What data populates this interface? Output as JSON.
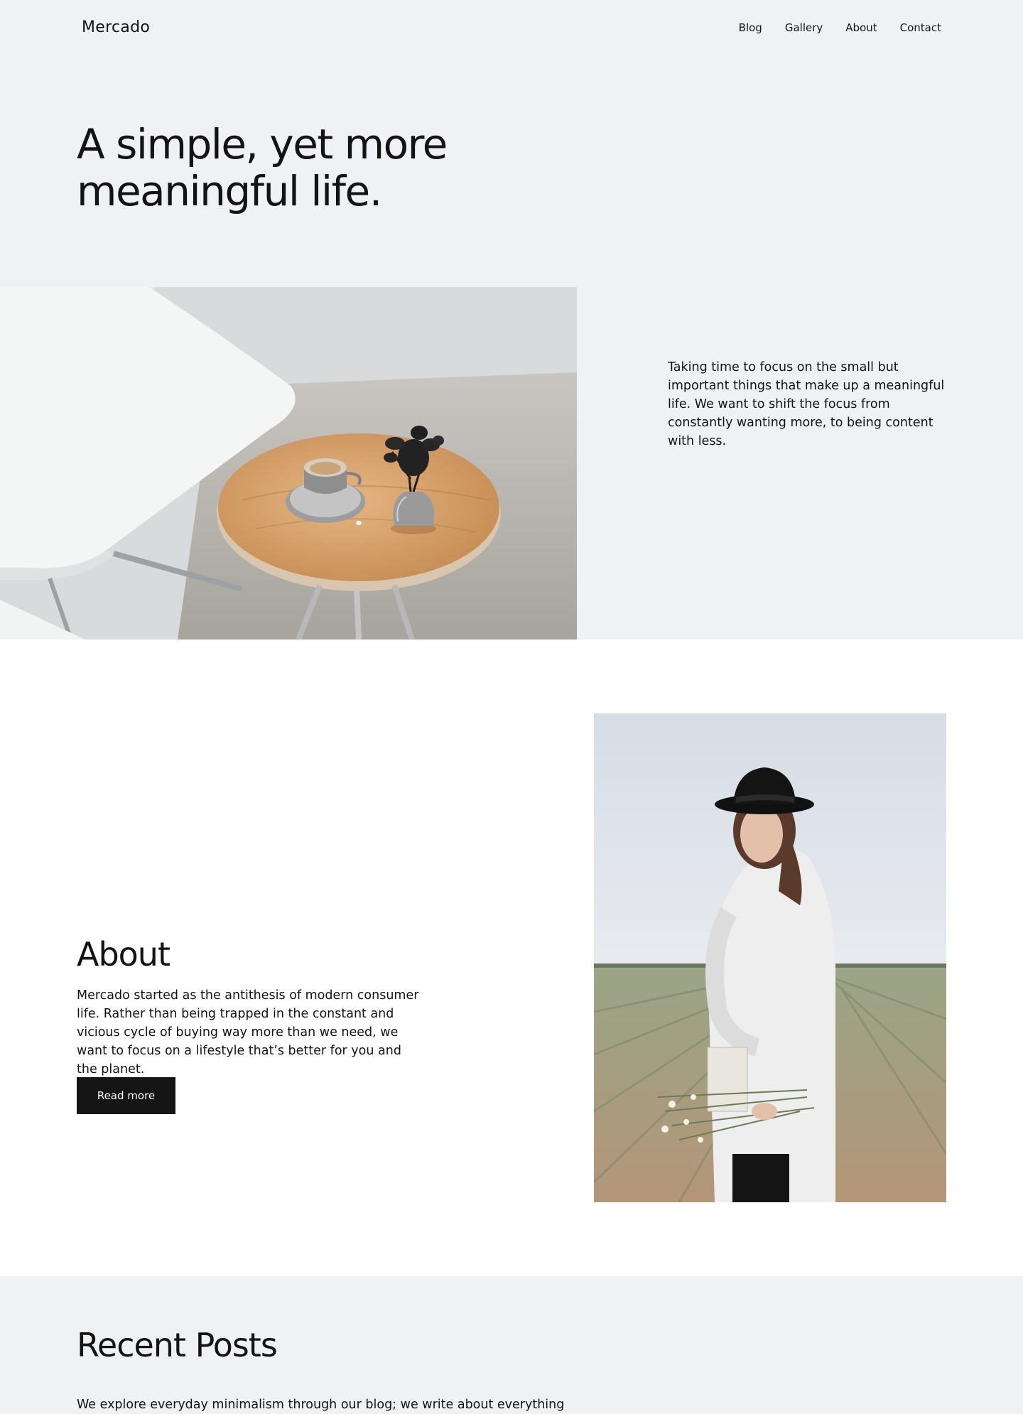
{
  "header": {
    "logo": "Mercado",
    "nav": [
      "Blog",
      "Gallery",
      "About",
      "Contact"
    ]
  },
  "hero": {
    "title": "A simple, yet more meaningful life.",
    "text": "Taking time to focus on the small but important things that make up a meaningful life. We want to shift the focus from constantly wanting more, to being content with less."
  },
  "about": {
    "title": "About",
    "text": "Mercado started as the antithesis of modern consumer life. Rather than being trapped in the constant and vicious cycle of buying way more than we need, we want to focus on a lifestyle that’s better for you and the planet.",
    "button_label": "Read more"
  },
  "posts": {
    "title": "Recent Posts",
    "text": "We explore everyday minimalism through our blog; we write about everything"
  },
  "colors": {
    "page_bg": "#f0f1f4",
    "section_bg": "#ffffff",
    "text": "#131313",
    "button_bg": "#151515"
  }
}
